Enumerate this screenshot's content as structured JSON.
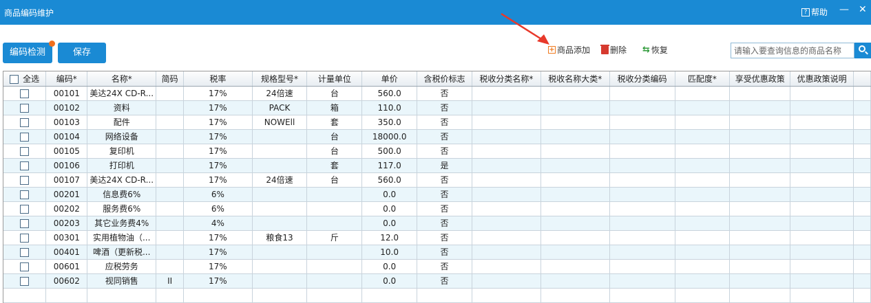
{
  "window": {
    "title": "商品编码维护",
    "help_label": "帮助",
    "help_icon": "?",
    "minimize_glyph": "—",
    "close_glyph": "✕"
  },
  "toolbar": {
    "check_label": "编码检测",
    "save_label": "保存",
    "add_label": "商品添加",
    "add_icon": "+",
    "delete_label": "删除",
    "restore_label": "恢复",
    "restore_icon": "⇆",
    "search_placeholder": "请输入要查询信息的商品名称"
  },
  "colors": {
    "accent": "#1a8ad4",
    "badge": "#f06f1e",
    "add_icon": "#f07a1e",
    "delete_icon": "#d63a2f",
    "restore_icon": "#2f9a3a",
    "arrow": "#e8392b"
  },
  "table": {
    "select_all_label": "全选",
    "columns": [
      "编码*",
      "名称*",
      "简码",
      "税率",
      "规格型号*",
      "计量单位",
      "单价",
      "含税价标志",
      "税收分类名称*",
      "税收名称大类*",
      "税收分类编码",
      "匹配度*",
      "享受优惠政策",
      "优惠政策说明"
    ],
    "rows": [
      [
        "00101",
        "美达24X CD-R...",
        "",
        "17%",
        "24倍速",
        "台",
        "560.0",
        "否"
      ],
      [
        "00102",
        "资料",
        "",
        "17%",
        "PACK",
        "箱",
        "110.0",
        "否"
      ],
      [
        "00103",
        "配件",
        "",
        "17%",
        "NOWEll",
        "套",
        "350.0",
        "否"
      ],
      [
        "00104",
        "网络设备",
        "",
        "17%",
        "",
        "台",
        "18000.0",
        "否"
      ],
      [
        "00105",
        "复印机",
        "",
        "17%",
        "",
        "台",
        "500.0",
        "否"
      ],
      [
        "00106",
        "打印机",
        "",
        "17%",
        "",
        "套",
        "117.0",
        "是"
      ],
      [
        "00107",
        "美达24X CD-R...",
        "",
        "17%",
        "24倍速",
        "台",
        "560.0",
        "否"
      ],
      [
        "00201",
        "信息费6%",
        "",
        "6%",
        "",
        "",
        "0.0",
        "否"
      ],
      [
        "00202",
        "服务费6%",
        "",
        "6%",
        "",
        "",
        "0.0",
        "否"
      ],
      [
        "00203",
        "其它业务费4%",
        "",
        "4%",
        "",
        "",
        "0.0",
        "否"
      ],
      [
        "00301",
        "实用植物油（...",
        "",
        "17%",
        "粮食13",
        "斤",
        "12.0",
        "否"
      ],
      [
        "00401",
        "啤酒（更新税...",
        "",
        "17%",
        "",
        "",
        "10.0",
        "否"
      ],
      [
        "00601",
        "应税劳务",
        "",
        "17%",
        "",
        "",
        "0.0",
        "否"
      ],
      [
        "00602",
        "视同销售",
        "II",
        "17%",
        "",
        "",
        "0.0",
        "否"
      ]
    ]
  }
}
